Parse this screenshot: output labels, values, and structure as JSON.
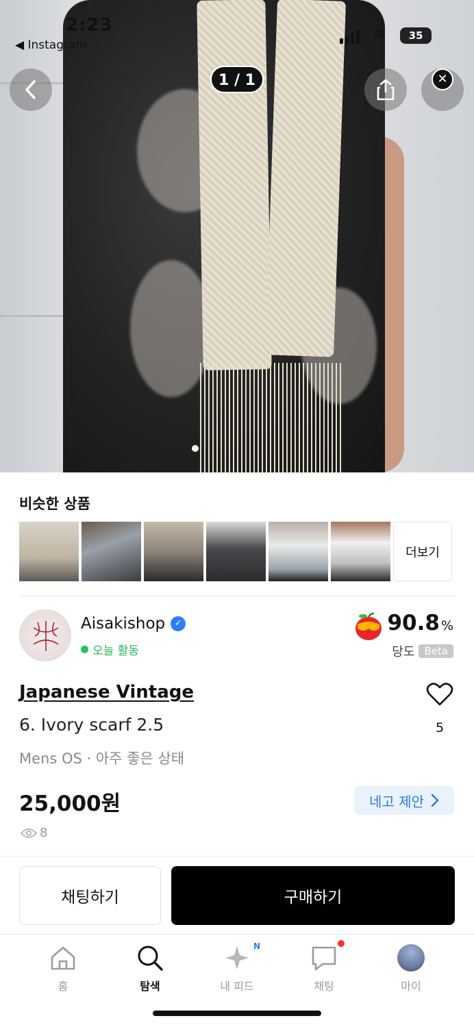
{
  "status_bar": {
    "time": "2:23",
    "back_app": "◀ Instagram",
    "battery": "35"
  },
  "gallery": {
    "counter": "1 / 1"
  },
  "similar": {
    "title": "비슷한 상품",
    "more_label": "더보기",
    "thumbnail_count": 6
  },
  "seller": {
    "name": "Aisakishop",
    "activity": "오늘 활동",
    "score": "90.8",
    "score_unit": "%",
    "score_label": "당도",
    "beta": "Beta"
  },
  "item": {
    "brand": "Japanese Vintage",
    "title": "6. Ivory scarf 2.5",
    "meta": "Mens OS · 아주 좋은 상태",
    "like_count": "5",
    "price": "25,000원",
    "offer_label": "네고 제안",
    "views": "8"
  },
  "actions": {
    "chat_label": "채팅하기",
    "buy_label": "구매하기"
  },
  "tabbar": {
    "items": [
      {
        "label": "홈",
        "icon": "home-icon"
      },
      {
        "label": "탐색",
        "icon": "search-icon"
      },
      {
        "label": "내 피드",
        "icon": "sparkle-icon",
        "badge": "N"
      },
      {
        "label": "채팅",
        "icon": "chat-icon"
      },
      {
        "label": "마이",
        "icon": "profile-avatar"
      }
    ]
  },
  "colors": {
    "accent_blue": "#2a7ae2",
    "active_green": "#22b45a",
    "buy_button": "#000000"
  }
}
